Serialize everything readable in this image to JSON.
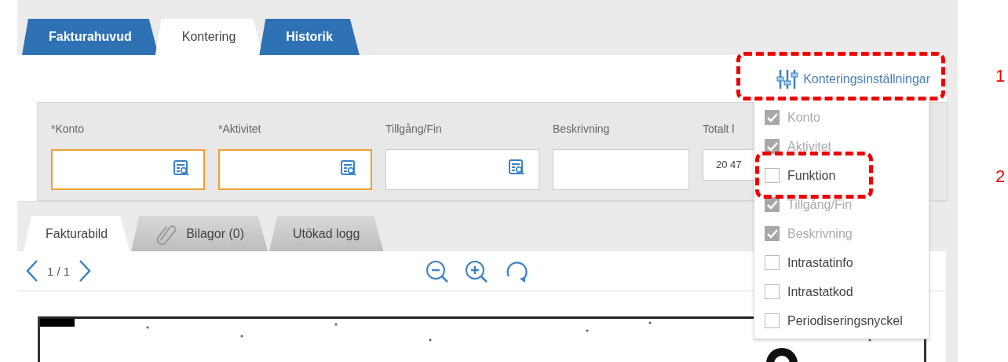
{
  "top_tabs": [
    {
      "label": "Fakturahuvud",
      "selected": false
    },
    {
      "label": "Kontering",
      "selected": true
    },
    {
      "label": "Historik",
      "selected": false
    }
  ],
  "settings_button": {
    "label": "Konteringsinställningar"
  },
  "fields": [
    {
      "label": "*Konto",
      "kind": "lookup",
      "invalid": true
    },
    {
      "label": "*Aktivitet",
      "kind": "lookup",
      "invalid": true
    },
    {
      "label": "Tillgång/Fin",
      "kind": "lookup",
      "invalid": false
    },
    {
      "label": "Beskrivning",
      "kind": "text",
      "invalid": false
    },
    {
      "label": "Totalt l",
      "kind": "amount",
      "value": "20 47"
    }
  ],
  "settings_menu": [
    {
      "label": "Konto",
      "checked": true,
      "disabled": true
    },
    {
      "label": "Aktivitet",
      "checked": true,
      "disabled": true
    },
    {
      "label": "Funktion",
      "checked": false,
      "disabled": false
    },
    {
      "label": "Tillgång/Fin",
      "checked": true,
      "disabled": true
    },
    {
      "label": "Beskrivning",
      "checked": true,
      "disabled": true
    },
    {
      "label": "Intrastatinfo",
      "checked": false,
      "disabled": false
    },
    {
      "label": "Intrastatkod",
      "checked": false,
      "disabled": false
    },
    {
      "label": "Periodiseringsnyckel",
      "checked": false,
      "disabled": false
    }
  ],
  "lower_tabs": [
    {
      "label": "Fakturabild",
      "selected": true,
      "kind": "plain"
    },
    {
      "label": "Bilagor (0)",
      "selected": false,
      "kind": "attachments"
    },
    {
      "label": "Utökad logg",
      "selected": false,
      "kind": "plain"
    }
  ],
  "viewer": {
    "page": "1 / 1"
  },
  "annotations": [
    {
      "number": "1"
    },
    {
      "number": "2"
    }
  ]
}
